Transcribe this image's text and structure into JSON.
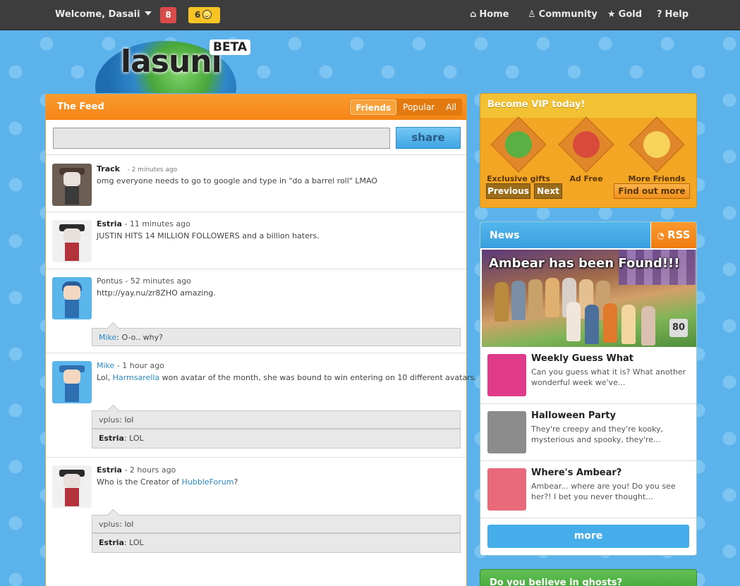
{
  "topbar": {
    "welcome": "Welcome, Dasaii",
    "messages_count": "8",
    "friends_count": "6",
    "nav": [
      {
        "label": "Home",
        "icon": "home-icon"
      },
      {
        "label": "Community",
        "icon": "user-icon"
      },
      {
        "label": "Gold",
        "icon": "star-icon"
      },
      {
        "label": "Help",
        "icon": "question-icon"
      }
    ]
  },
  "logo": {
    "text": "lasuni",
    "badge": "BETA"
  },
  "feed": {
    "title": "The Feed",
    "tabs": [
      "Friends",
      "Popular",
      "All"
    ],
    "active_tab": "Friends",
    "share_label": "share",
    "posts": [
      {
        "user": "Track",
        "time": "- 2 minutes ago",
        "text": "omg everyone needs to go to google and type in \"do a barrel roll\" LMAO"
      },
      {
        "user": "Estria",
        "time": "- 11 minutes ago",
        "text": "JUSTIN HITS 14 MILLION FOLLOWERS and a billion haters."
      },
      {
        "user": "Pontus",
        "time": "- 52 minutes ago",
        "text": "http://yay.nu/zr8ZHO amazing.",
        "replies": [
          {
            "user": "Mike",
            "text": ": O-o.. why?"
          }
        ]
      },
      {
        "user": "Mike",
        "time": "- 1 hour ago",
        "text_pre": "Lol, ",
        "text_link": "Harmsarella",
        "text_post": " won avatar of the month, she was bound to win entering on 10 different avatars.",
        "replies": [
          {
            "user": "vplus",
            "text": ": lol"
          },
          {
            "user": "Estria",
            "text": ": LOL"
          }
        ]
      },
      {
        "user": "Estria",
        "time": "- 2 hours ago",
        "text_pre": "Who is the Creator of ",
        "text_link": "HubbleForum",
        "text_post": "?",
        "replies": [
          {
            "user": "vplus",
            "text": ": lol"
          },
          {
            "user": "Estria",
            "text": ": LOL"
          }
        ]
      }
    ]
  },
  "vip": {
    "title": "Become VIP today!",
    "items": [
      "Exclusive gifts",
      "Ad Free",
      "More Friends"
    ],
    "prev": "Previous",
    "next": "Next",
    "find_more": "Find out more"
  },
  "news": {
    "title": "News",
    "rss": "RSS",
    "hero_title": "Ambear has been Found!!!",
    "hero_count": "80",
    "items": [
      {
        "title": "Weekly Guess What",
        "desc": "Can you guess what it is? What another wonderful week we've..."
      },
      {
        "title": "Halloween Party",
        "desc": "They're creepy and they're kooky, mysterious and spooky, they're..."
      },
      {
        "title": "Where's Ambear?",
        "desc": "Ambear... where are you! Do you see her?! I bet you never thought..."
      }
    ],
    "more": "more"
  },
  "ghost": {
    "title": "Do you believe in ghosts?"
  },
  "colors": {
    "accent_orange": "#f58515",
    "accent_blue": "#3a9fdd",
    "vip_gold": "#f3c234",
    "link": "#2a8ac6"
  }
}
